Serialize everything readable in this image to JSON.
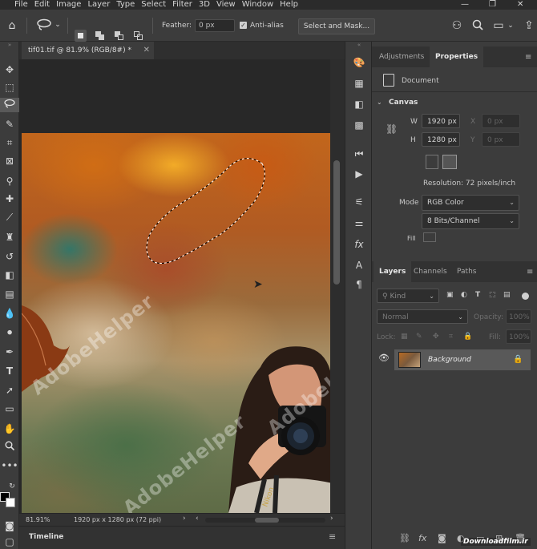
{
  "menu": [
    "File",
    "Edit",
    "Image",
    "Layer",
    "Type",
    "Select",
    "Filter",
    "3D",
    "View",
    "Window",
    "Help"
  ],
  "options": {
    "feather_label": "Feather:",
    "feather_value": "0 px",
    "antialias_label": "Anti-alias",
    "antialias_checked": true,
    "select_mask_label": "Select and Mask..."
  },
  "document": {
    "tab_title": "tif01.tif @ 81.9% (RGB/8#) *",
    "zoom": "81.91%",
    "info": "1920 px x 1280 px (72 ppi)",
    "watermark": "AdobeHelper",
    "camera_text": "Nikon"
  },
  "timeline_label": "Timeline",
  "properties": {
    "tab_adjustments": "Adjustments",
    "tab_properties": "Properties",
    "section_doc": "Document",
    "section_canvas": "Canvas",
    "w_label": "W",
    "w_value": "1920 px",
    "h_label": "H",
    "h_value": "1280 px",
    "x_label": "X",
    "x_value": "0 px",
    "y_label": "Y",
    "y_value": "0 px",
    "resolution": "Resolution: 72 pixels/inch",
    "mode_label": "Mode",
    "mode_value": "RGB Color",
    "bits_value": "8 Bits/Channel",
    "fill_label": "Fill"
  },
  "layers": {
    "tab_layers": "Layers",
    "tab_channels": "Channels",
    "tab_paths": "Paths",
    "filter_kind": "Kind",
    "blend_mode": "Normal",
    "opacity_label": "Opacity:",
    "opacity_value": "100%",
    "lock_label": "Lock:",
    "fill_label": "Fill:",
    "fill_value": "100%",
    "layer_name": "Background"
  },
  "site_watermark": "Downloadfilm.ir",
  "icons": {
    "home": "home-icon",
    "lasso": "lasso-icon",
    "search": "search-icon",
    "visibility": "eye-icon",
    "lock": "lock-icon"
  }
}
